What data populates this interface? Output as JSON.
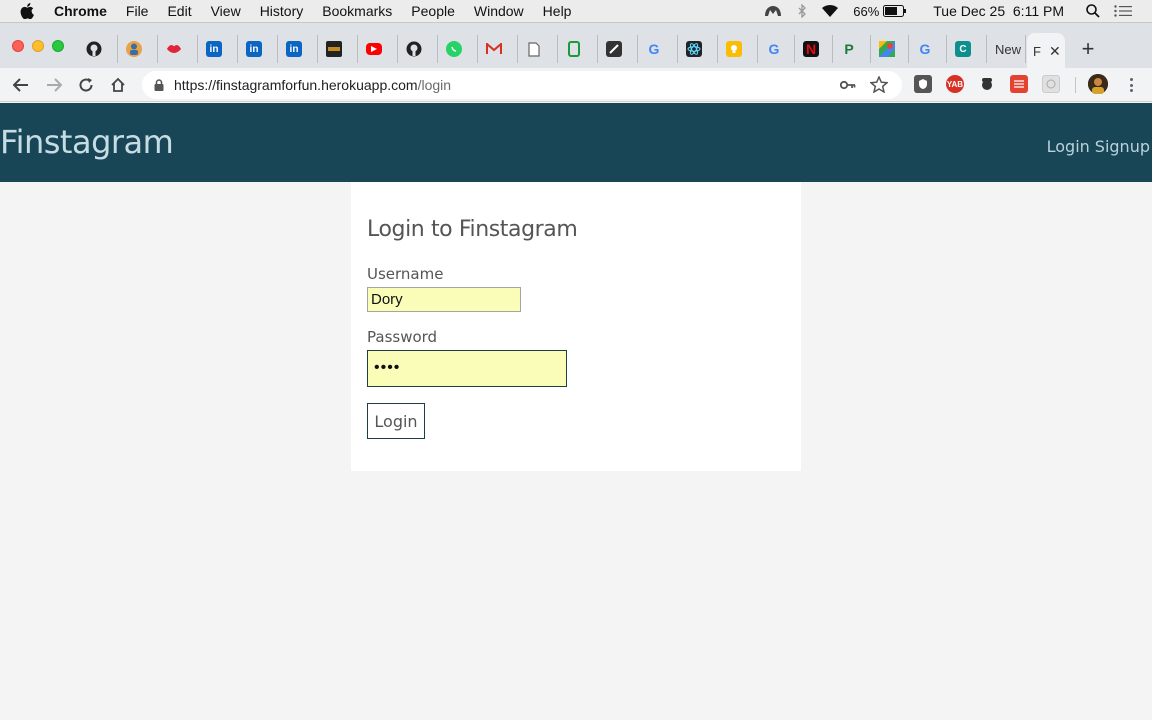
{
  "menubar": {
    "app": "Chrome",
    "items": [
      "File",
      "Edit",
      "View",
      "History",
      "Bookmarks",
      "People",
      "Window",
      "Help"
    ],
    "battery": "66%",
    "clock": "Tue Dec 25  6:11 PM"
  },
  "tabs": {
    "new_tab_label": "New",
    "active_label": "F"
  },
  "omnibox": {
    "url_host": "https://finstagramforfun.herokuapp.com",
    "url_path": "/login"
  },
  "app": {
    "brand": "Finstagram",
    "nav_login": "Login",
    "nav_signup": "Signup"
  },
  "login": {
    "title": "Login to Finstagram",
    "username_label": "Username",
    "username_value": "Dory",
    "password_label": "Password",
    "password_masked": "••••",
    "submit_label": "Login"
  },
  "colors": {
    "header_bg": "#194656",
    "autofill_bg": "#f9fdb7",
    "page_bg": "#f4f4f4"
  }
}
